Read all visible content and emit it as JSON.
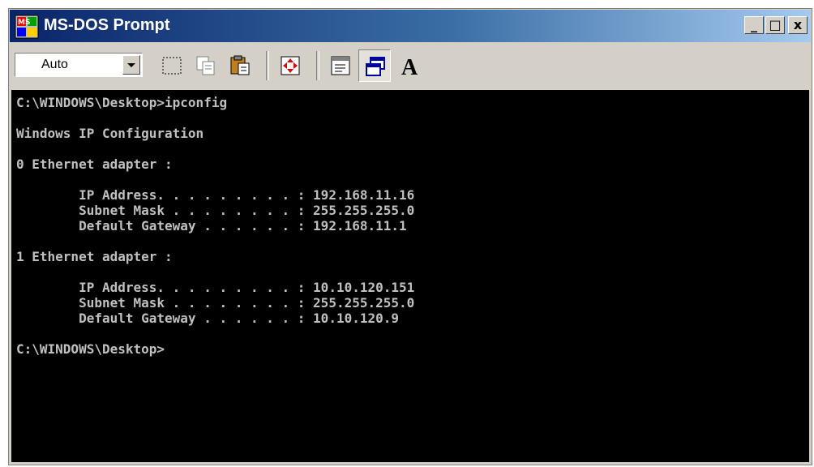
{
  "window": {
    "title": "MS-DOS Prompt",
    "caption_buttons": {
      "minimize": "_",
      "maximize": "□",
      "close": "x"
    }
  },
  "toolbar": {
    "font_select": "Auto",
    "buttons": [
      {
        "name": "mark-icon"
      },
      {
        "name": "copy-icon"
      },
      {
        "name": "paste-icon"
      },
      {
        "name": "fullscreen-icon"
      },
      {
        "name": "properties-icon"
      },
      {
        "name": "background-icon"
      },
      {
        "name": "font-icon",
        "label": "A"
      }
    ]
  },
  "console": {
    "lines": [
      "C:\\WINDOWS\\Desktop>ipconfig",
      "",
      "Windows IP Configuration",
      "",
      "0 Ethernet adapter :",
      "",
      "        IP Address. . . . . . . . . : 192.168.11.16",
      "        Subnet Mask . . . . . . . . : 255.255.255.0",
      "        Default Gateway . . . . . . : 192.168.11.1",
      "",
      "1 Ethernet adapter :",
      "",
      "        IP Address. . . . . . . . . : 10.10.120.151",
      "        Subnet Mask . . . . . . . . : 255.255.255.0",
      "        Default Gateway . . . . . . : 10.10.120.9",
      "",
      "C:\\WINDOWS\\Desktop>"
    ]
  },
  "colors": {
    "titlebar_start": "#0a246a",
    "titlebar_end": "#a6caf0",
    "console_bg": "#000000",
    "console_fg": "#c0c0c0",
    "chrome": "#d4d0c8"
  }
}
